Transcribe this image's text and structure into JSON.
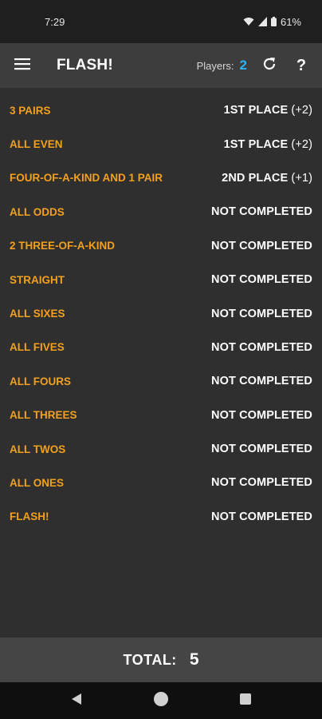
{
  "status_bar": {
    "time": "7:29",
    "battery": "61%",
    "icons": [
      "wifi-icon",
      "signal-icon",
      "battery-icon"
    ]
  },
  "app_bar": {
    "title": "FLASH!",
    "players_label": "Players:",
    "players_count": "2",
    "help_label": "?",
    "icons": [
      "menu-icon",
      "refresh-icon"
    ]
  },
  "rows": [
    {
      "label": "3 PAIRS",
      "status": "1ST PLACE",
      "points": "(+2)"
    },
    {
      "label": "ALL EVEN",
      "status": "1ST PLACE",
      "points": "(+2)"
    },
    {
      "label": "FOUR-OF-A-KIND AND 1 PAIR",
      "status": "2ND PLACE",
      "points": "(+1)"
    },
    {
      "label": "ALL ODDS",
      "status": "NOT COMPLETED",
      "points": ""
    },
    {
      "label": "2 THREE-OF-A-KIND",
      "status": "NOT COMPLETED",
      "points": ""
    },
    {
      "label": "STRAIGHT",
      "status": "NOT COMPLETED",
      "points": ""
    },
    {
      "label": "ALL SIXES",
      "status": "NOT COMPLETED",
      "points": ""
    },
    {
      "label": "ALL FIVES",
      "status": "NOT COMPLETED",
      "points": ""
    },
    {
      "label": "ALL FOURS",
      "status": "NOT COMPLETED",
      "points": ""
    },
    {
      "label": "ALL THREES",
      "status": "NOT COMPLETED",
      "points": ""
    },
    {
      "label": "ALL TWOS",
      "status": "NOT COMPLETED",
      "points": ""
    },
    {
      "label": "ALL ONES",
      "status": "NOT COMPLETED",
      "points": ""
    },
    {
      "label": "FLASH!",
      "status": "NOT COMPLETED",
      "points": ""
    }
  ],
  "total": {
    "label": "TOTAL:",
    "value": "5"
  },
  "nav_bar": {
    "icons": [
      "back-icon",
      "home-icon",
      "recents-icon"
    ]
  },
  "colors": {
    "accent_label": "#f2a01e",
    "players_count": "#29b6f6",
    "background": "#2f2f2f",
    "app_bar": "#3d3d3d"
  }
}
